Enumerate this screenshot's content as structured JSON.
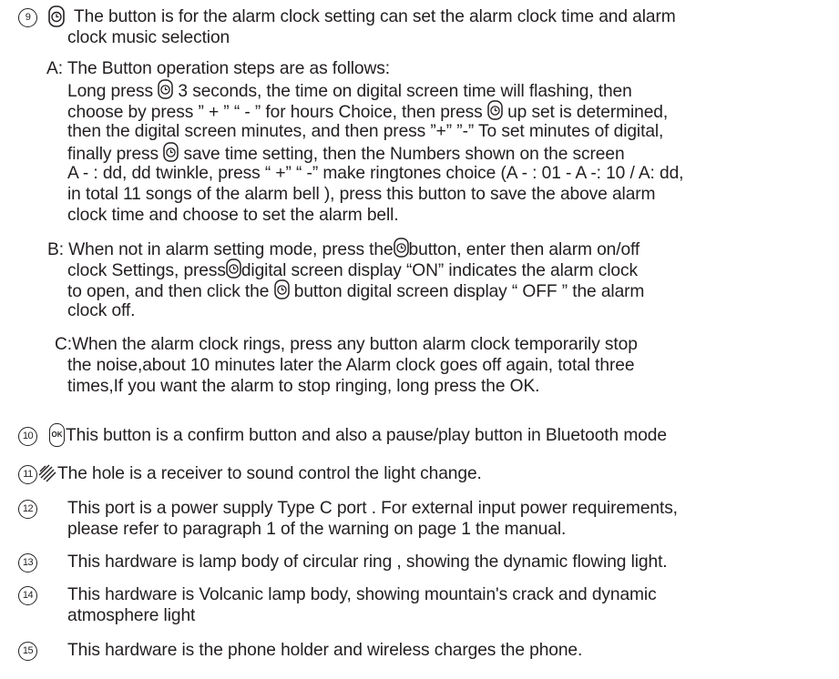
{
  "section9": {
    "number": "9",
    "line1": "The button is for the alarm clock setting  can set the alarm clock time and alarm",
    "line2": "clock music selection",
    "icon": "alarm-clock-icon"
  },
  "sectionA": {
    "heading": "A: The Button operation steps are as follows:",
    "l1a": "Long press ",
    "l1b": " 3 seconds, the time on  digital screen time will flashing,  then",
    "l2a": "choose by press ” + ” “ - ”  for hours Choice, then press ",
    "l2b": " up set is determined,",
    "l3": "then the digital screen minutes, and then press ”+” ”-” To set minutes of digital,",
    "l4a": "finally press ",
    "l4b": " save time setting, then the Numbers shown on the screen",
    "l5": "A - : dd, dd twinkle, press “ +” “ -”  make ringtones choice (A - : 01 - A -: 10 / A: dd,",
    "l6": "in total  11 songs of  the alarm bell ), press this button to save the above alarm",
    "l7": "clock time and choose to set the alarm bell."
  },
  "sectionB": {
    "l1a": "B: When not in alarm setting mode, press the",
    "l1b": "button, enter then alarm on/off",
    "l2a": "clock Settings, press",
    "l2b": "digital screen display “ON”  indicates the alarm clock",
    "l3a": "to open, and then click the ",
    "l3b": " button digital screen display “ OFF ” the alarm",
    "l4": "clock off."
  },
  "sectionC": {
    "l1": "C:When the alarm clock rings, press any button alarm clock  temporarily stop",
    "l2": "the noise,about 10 minutes later the Alarm clock goes off again,  total  three",
    "l3": "times,If you want the alarm to stop ringing, long press the OK."
  },
  "section10": {
    "number": "10",
    "icon_text": "OK",
    "text": "This button is a confirm button and also a pause/play button in Bluetooth mode"
  },
  "section11": {
    "number": "11",
    "icon": "hatched-hole-icon",
    "text": "The hole is a receiver to sound control the light change."
  },
  "section12": {
    "number": "12",
    "l1": "This port is a power supply Type C port . For external input power requirements,",
    "l2": "please refer to paragraph 1 of the warning on page 1 the manual."
  },
  "section13": {
    "number": "13",
    "text": "This hardware is lamp body of circular ring , showing the dynamic flowing light."
  },
  "section14": {
    "number": "14",
    "l1": "This hardware is Volcanic  lamp body, showing mountain's crack and dynamic",
    "l2": "atmosphere light"
  },
  "section15": {
    "number": "15",
    "text": "This hardware is the phone holder and wireless charges the phone."
  },
  "colors": {
    "text": "#231f20",
    "background": "#ffffff"
  }
}
